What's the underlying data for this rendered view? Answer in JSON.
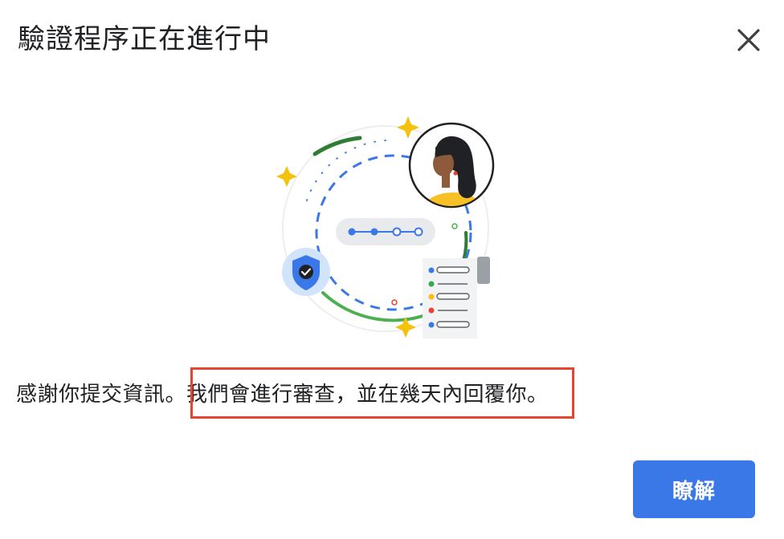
{
  "dialog": {
    "title": "驗證程序正在進行中",
    "close_icon": "close-icon",
    "message_before": "感謝你提交資訊。",
    "message_highlighted": "我們會進行審查，並在幾天內回覆你",
    "message_after": "。",
    "ok_label": "瞭解",
    "highlight_color": "#e8432f",
    "accent_color": "#3b78e7"
  },
  "illustration": {
    "icons": [
      "avatar",
      "shield-check-icon",
      "progress-steps",
      "document-list-icon",
      "sparkle-icon"
    ]
  }
}
